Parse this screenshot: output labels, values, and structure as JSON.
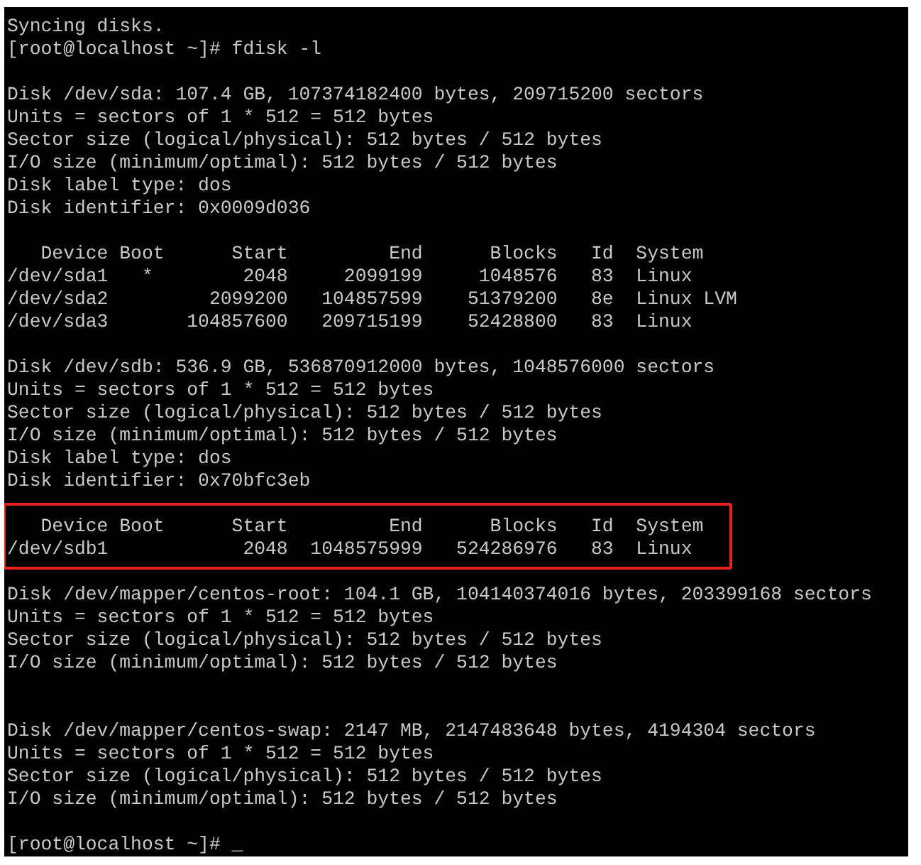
{
  "terminal": {
    "lines": [
      {
        "kind": "line",
        "text": "Syncing disks."
      },
      {
        "kind": "line",
        "text": "[root@localhost ~]# fdisk -l"
      },
      {
        "kind": "blank"
      },
      {
        "kind": "line",
        "text": "Disk /dev/sda: 107.4 GB, 107374182400 bytes, 209715200 sectors"
      },
      {
        "kind": "line",
        "text": "Units = sectors of 1 * 512 = 512 bytes"
      },
      {
        "kind": "line",
        "text": "Sector size (logical/physical): 512 bytes / 512 bytes"
      },
      {
        "kind": "line",
        "text": "I/O size (minimum/optimal): 512 bytes / 512 bytes"
      },
      {
        "kind": "line",
        "text": "Disk label type: dos"
      },
      {
        "kind": "line",
        "text": "Disk identifier: 0x0009d036"
      },
      {
        "kind": "blank"
      },
      {
        "kind": "line",
        "text": "   Device Boot      Start         End      Blocks   Id  System"
      },
      {
        "kind": "line",
        "text": "/dev/sda1   *        2048     2099199     1048576   83  Linux"
      },
      {
        "kind": "line",
        "text": "/dev/sda2         2099200   104857599    51379200   8e  Linux LVM"
      },
      {
        "kind": "line",
        "text": "/dev/sda3       104857600   209715199    52428800   83  Linux"
      },
      {
        "kind": "blank"
      },
      {
        "kind": "line",
        "text": "Disk /dev/sdb: 536.9 GB, 536870912000 bytes, 1048576000 sectors"
      },
      {
        "kind": "line",
        "text": "Units = sectors of 1 * 512 = 512 bytes"
      },
      {
        "kind": "line",
        "text": "Sector size (logical/physical): 512 bytes / 512 bytes"
      },
      {
        "kind": "line",
        "text": "I/O size (minimum/optimal): 512 bytes / 512 bytes"
      },
      {
        "kind": "line",
        "text": "Disk label type: dos"
      },
      {
        "kind": "line",
        "text": "Disk identifier: 0x70bfc3eb"
      },
      {
        "kind": "blank"
      },
      {
        "kind": "highlight",
        "lines": [
          {
            "text": "   Device Boot      Start         End      Blocks   Id  System"
          },
          {
            "text": "/dev/sdb1            2048  1048575999   524286976   83  Linux"
          }
        ]
      },
      {
        "kind": "blank"
      },
      {
        "kind": "line",
        "text": "Disk /dev/mapper/centos-root: 104.1 GB, 104140374016 bytes, 203399168 sectors"
      },
      {
        "kind": "line",
        "text": "Units = sectors of 1 * 512 = 512 bytes"
      },
      {
        "kind": "line",
        "text": "Sector size (logical/physical): 512 bytes / 512 bytes"
      },
      {
        "kind": "line",
        "text": "I/O size (minimum/optimal): 512 bytes / 512 bytes"
      },
      {
        "kind": "blank"
      },
      {
        "kind": "blank"
      },
      {
        "kind": "line",
        "text": "Disk /dev/mapper/centos-swap: 2147 MB, 2147483648 bytes, 4194304 sectors"
      },
      {
        "kind": "line",
        "text": "Units = sectors of 1 * 512 = 512 bytes"
      },
      {
        "kind": "line",
        "text": "Sector size (logical/physical): 512 bytes / 512 bytes"
      },
      {
        "kind": "line",
        "text": "I/O size (minimum/optimal): 512 bytes / 512 bytes"
      },
      {
        "kind": "blank"
      },
      {
        "kind": "line",
        "text": "[root@localhost ~]# _"
      }
    ]
  }
}
